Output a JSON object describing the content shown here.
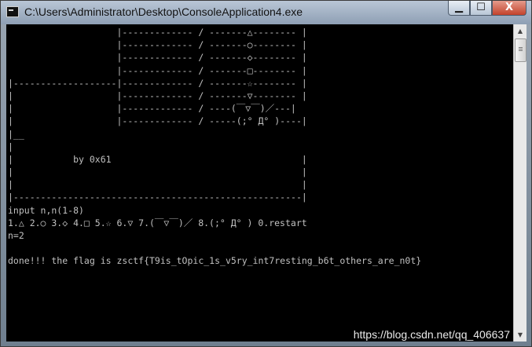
{
  "window": {
    "title": "C:\\Users\\Administrator\\Desktop\\ConsoleApplication4.exe",
    "controls": {
      "minimize": "▁",
      "maximize": "☐",
      "close": "X"
    }
  },
  "console": {
    "lines": [
      "                    |------------- / -------△-------- |",
      "                    |------------- / -------○-------- |",
      "                    |------------- / -------◇-------- |",
      "                    |------------- / -------□-------- |",
      "|-------------------|------------- / -------☆-------- |",
      "|                   |------------- / -------▽-------- |",
      "|                   |------------- / ----(￣▽￣)／---|",
      "|                   |------------- / -----(;° Д° )----|",
      "|__",
      "|",
      "|           by 0x61                                   |",
      "|                                                     |",
      "|                                                     |",
      "|-----------------------------------------------------|",
      "input n,n(1-8)",
      "1.△ 2.○ 3.◇ 4.□ 5.☆ 6.▽ 7.(￣▽￣)／ 8.(;° Д° ) 0.restart",
      "n=2",
      "",
      "done!!! the flag is zsctf{T9is_tOpic_1s_v5ry_int7resting_b6t_others_are_n0t}"
    ]
  },
  "watermark": "https://blog.csdn.net/qq_406637"
}
